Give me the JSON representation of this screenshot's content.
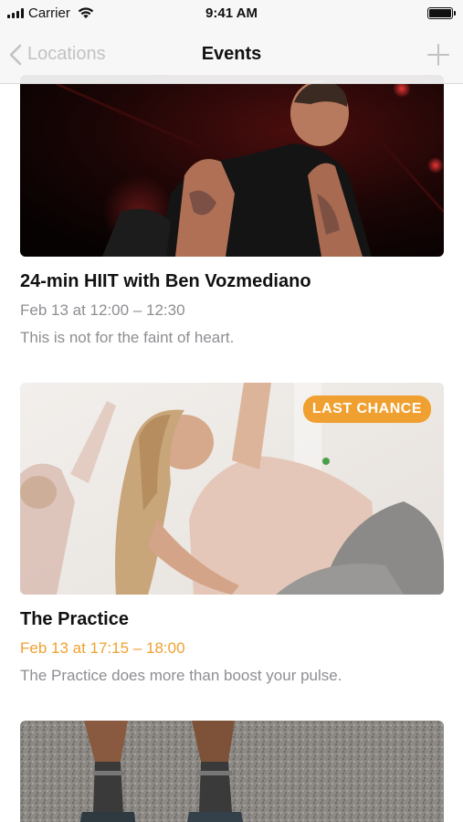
{
  "status_bar": {
    "carrier": "Carrier",
    "time": "9:41 AM"
  },
  "nav": {
    "back_label": "Locations",
    "title": "Events",
    "add_icon": "plus-icon",
    "back_icon": "chevron-left-icon"
  },
  "events": [
    {
      "title": "24-min HIIT with Ben Vozmediano",
      "date": "Feb 13 at 12:00 – 12:30",
      "description": "This is not for the faint of heart.",
      "badge": ""
    },
    {
      "title": "The Practice",
      "date": "Feb 13 at 17:15 – 18:00",
      "description": "The Practice does more than boost your pulse.",
      "badge": "LAST CHANCE"
    }
  ],
  "colors": {
    "accent": "#f0a030",
    "secondary_text": "#8e8e93",
    "inactive": "#c2c2c2"
  }
}
